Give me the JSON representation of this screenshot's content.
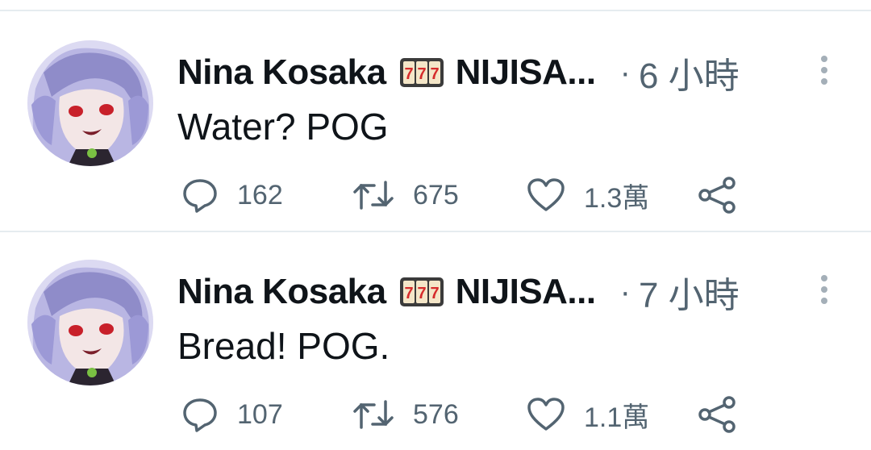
{
  "tweets": [
    {
      "author": "Nina Kosaka",
      "author_tail": "NIJISA...",
      "separator": "·",
      "time": "6 小時",
      "text": "Water? POG",
      "replies": "162",
      "retweets": "675",
      "likes": "1.3萬"
    },
    {
      "author": "Nina Kosaka",
      "author_tail": "NIJISA...",
      "separator": "·",
      "time": "7 小時",
      "text": "Bread! POG.",
      "replies": "107",
      "retweets": "576",
      "likes": "1.1萬"
    }
  ],
  "icons": {
    "name_emoji": "slot-machine-icon",
    "more": "more-vertical-icon",
    "reply": "reply-icon",
    "retweet": "retweet-icon",
    "like": "heart-icon",
    "share": "share-icon"
  },
  "colors": {
    "text": "#0f1419",
    "secondary": "#536471",
    "divider": "#e6ecf0"
  }
}
